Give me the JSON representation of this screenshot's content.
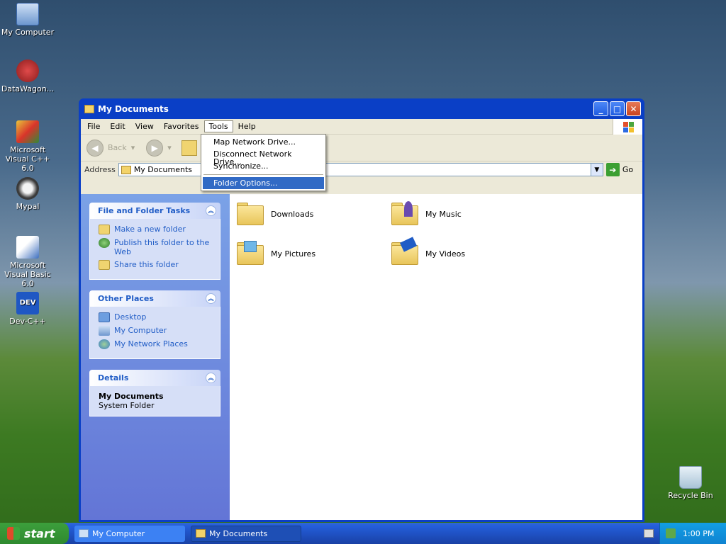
{
  "desktop": {
    "icons": [
      {
        "label": "My Computer"
      },
      {
        "label": "DataWagon..."
      },
      {
        "label": "Microsoft Visual C++ 6.0"
      },
      {
        "label": "Mypal"
      },
      {
        "label": "Microsoft Visual Basic 6.0"
      },
      {
        "label": "Dev-C++"
      },
      {
        "label": "Recycle Bin"
      }
    ]
  },
  "window": {
    "title": "My Documents",
    "menu": [
      "File",
      "Edit",
      "View",
      "Favorites",
      "Tools",
      "Help"
    ],
    "toolbar": {
      "back_label": "Back"
    },
    "address": {
      "label": "Address",
      "value": "My Documents",
      "go_label": "Go"
    }
  },
  "tools_menu": {
    "items": [
      "Map Network Drive...",
      "Disconnect Network Drive...",
      "Synchronize...",
      "Folder Options..."
    ],
    "selected": "Folder Options..."
  },
  "sidebar": {
    "file_tasks": {
      "title": "File and Folder Tasks",
      "items": [
        "Make a new folder",
        "Publish this folder to the Web",
        "Share this folder"
      ]
    },
    "other_places": {
      "title": "Other Places",
      "items": [
        "Desktop",
        "My Computer",
        "My Network Places"
      ]
    },
    "details": {
      "title": "Details",
      "name": "My Documents",
      "type": "System Folder"
    }
  },
  "files": [
    {
      "name": "Downloads",
      "kind": "folder"
    },
    {
      "name": "My Music",
      "kind": "music-folder"
    },
    {
      "name": "My Pictures",
      "kind": "pictures-folder"
    },
    {
      "name": "My Videos",
      "kind": "videos-folder"
    }
  ],
  "taskbar": {
    "start_label": "start",
    "buttons": [
      "My Computer",
      "My Documents"
    ],
    "active_button": "My Documents",
    "clock": "1:00 PM"
  }
}
